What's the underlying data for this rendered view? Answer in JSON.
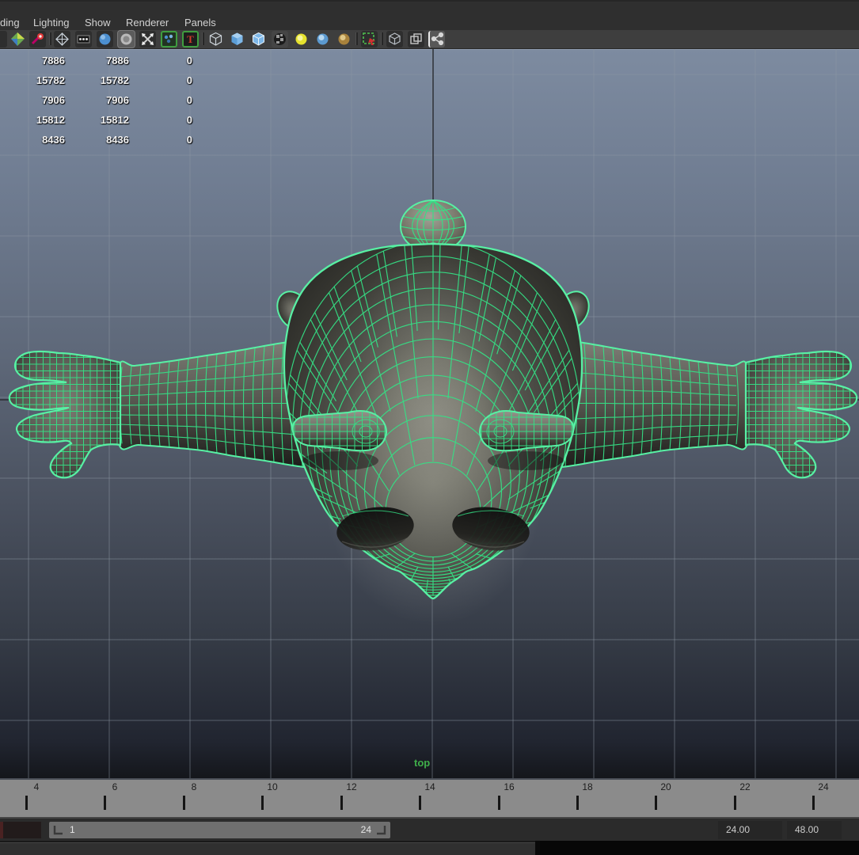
{
  "menu": {
    "items": [
      "ding",
      "Lighting",
      "Show",
      "Renderer",
      "Panels"
    ]
  },
  "toolbar": {
    "icons": [
      "snap-partial-icon",
      "shaded-display-icon",
      "snap-magnet-icon",
      "wireframe-diamond-icon",
      "film-gate-icon",
      "sphere-display-icon",
      "resolution-gate-icon",
      "x-arrows-icon",
      "texture-display-icon",
      "type-display-icon",
      "cube-wireframe-icon",
      "cube-shaded-icon",
      "cube-shaded-wire-icon",
      "textured-ball-icon",
      "light-yellow-icon",
      "light-blue-icon",
      "light-gold-icon",
      "isolate-select-icon",
      "plain-cube-icon",
      "duplicate-icon",
      "share-nodes-icon"
    ]
  },
  "hud": {
    "rows": [
      [
        "7886",
        "7886",
        "0"
      ],
      [
        "15782",
        "15782",
        "0"
      ],
      [
        "7906",
        "7906",
        "0"
      ],
      [
        "15812",
        "15812",
        "0"
      ],
      [
        "8436",
        "8436",
        "0"
      ]
    ]
  },
  "viewport": {
    "camera_label": "top",
    "camera_label_color": "#3fae4a",
    "wireframe_color": "#35e085",
    "outline_color": "#58f0a4"
  },
  "timeline": {
    "labels": [
      "4",
      "6",
      "8",
      "10",
      "12",
      "14",
      "16",
      "18",
      "20",
      "22",
      "24"
    ]
  },
  "rangebar": {
    "start": "1",
    "end": "24",
    "playback_end": "24.00",
    "anim_end": "48.00"
  }
}
